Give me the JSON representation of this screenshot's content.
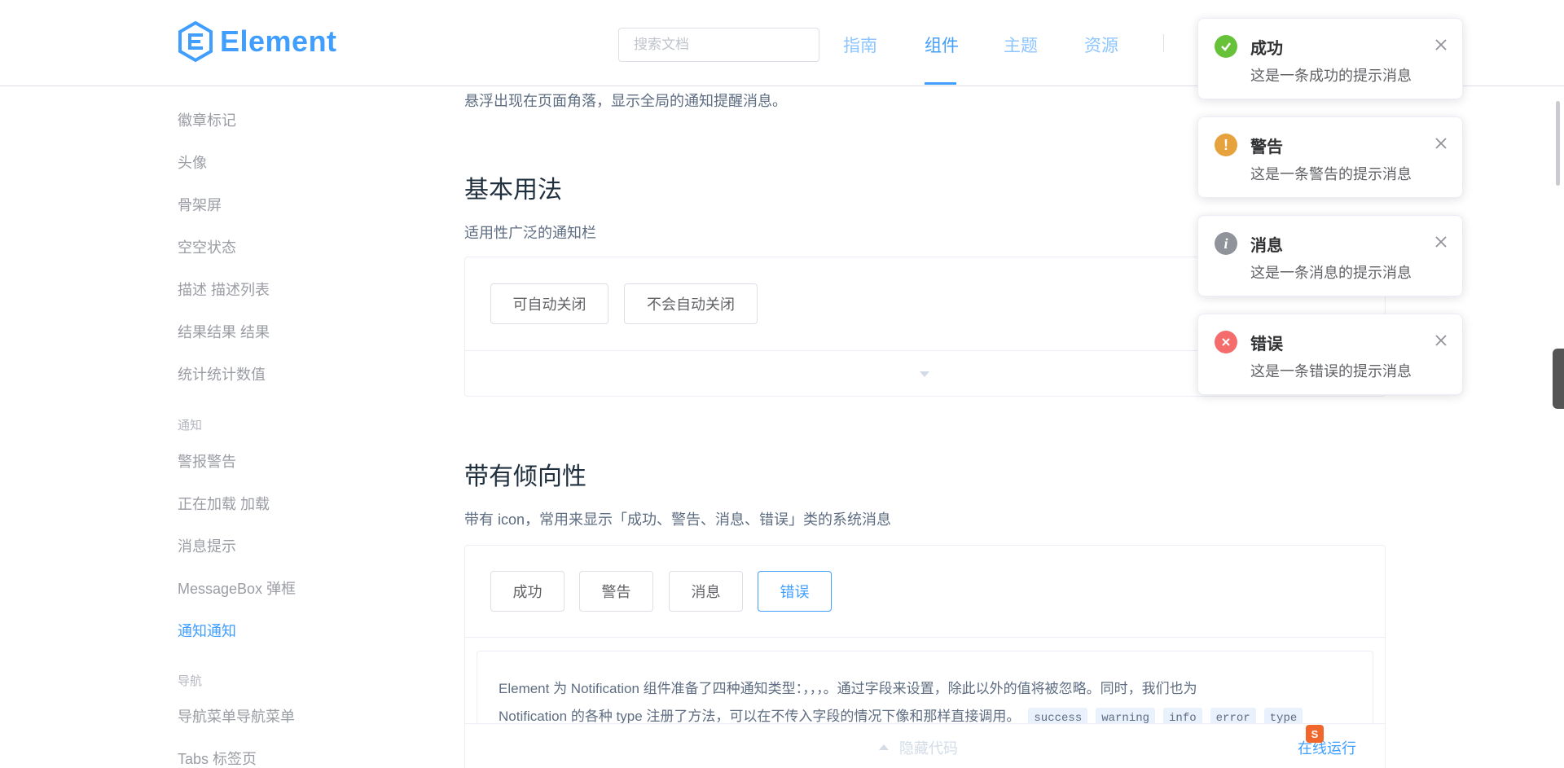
{
  "header": {
    "logo_text": "Element",
    "search_placeholder": "搜索文档",
    "nav": [
      "指南",
      "组件",
      "主题",
      "资源"
    ]
  },
  "sidebar": {
    "items": [
      "徽章标记",
      "头像",
      "骨架屏",
      "空空状态",
      "描述 描述列表",
      "结果结果 结果",
      "统计统计数值"
    ],
    "group_notify": "通知",
    "notify_items": [
      "警报警告",
      "正在加载 加载",
      "消息提示",
      "MessageBox 弹框",
      "通知通知"
    ],
    "group_nav": "导航",
    "nav_items": [
      "导航菜单导航菜单",
      "Tabs 标签页"
    ]
  },
  "main": {
    "intro": "悬浮出现在页面角落，显示全局的通知提醒消息。",
    "basic_title": "基本用法",
    "basic_desc": "适用性广泛的通知栏",
    "basic_buttons": [
      "可自动关闭",
      "不会自动关闭"
    ],
    "type_title": "带有倾向性",
    "type_desc": "带有 icon，常用来显示「成功、警告、消息、错误」类的系统消息",
    "type_buttons": [
      "成功",
      "警告",
      "消息",
      "错误"
    ],
    "desc_line1": "Element 为 Notification 组件准备了四种通知类型：，，，。通过字段来设置，除此以外的值将被忽略。同时，我们也为",
    "desc_line2": "Notification 的各种 type 注册了方法，可以在不传入字段的情况下像和那样直接调用。",
    "codes": [
      "success",
      "warning",
      "info",
      "error",
      "type"
    ],
    "hide_code": "隐藏代码",
    "run_online": "在线运行"
  },
  "notifications": [
    {
      "title": "成功",
      "message": "这是一条成功的提示消息",
      "color": "#67c23a",
      "icon": "check-icon"
    },
    {
      "title": "警告",
      "message": "这是一条警告的提示消息",
      "color": "#e6a23c",
      "icon": "warning-icon"
    },
    {
      "title": "消息",
      "message": "这是一条消息的提示消息",
      "color": "#909399",
      "icon": "info-icon"
    },
    {
      "title": "错误",
      "message": "这是一条错误的提示消息",
      "color": "#f56c6c",
      "icon": "error-icon"
    }
  ],
  "colors": {
    "primary": "#409eff",
    "primary_light": "#8dc5ff"
  }
}
